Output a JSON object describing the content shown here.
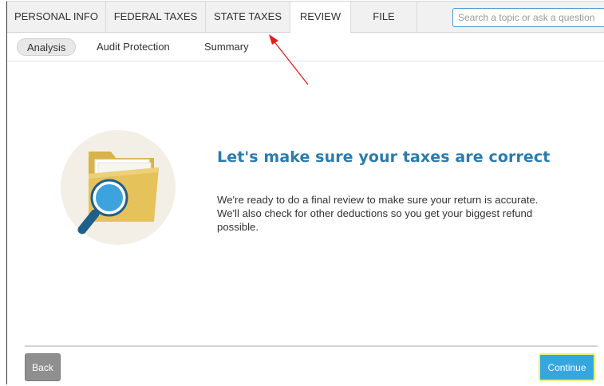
{
  "nav": {
    "tabs": [
      {
        "label": "PERSONAL INFO",
        "active": false
      },
      {
        "label": "FEDERAL TAXES",
        "active": false
      },
      {
        "label": "STATE TAXES",
        "active": false
      },
      {
        "label": "REVIEW",
        "active": true
      },
      {
        "label": "FILE",
        "active": false
      }
    ],
    "search_placeholder": "Search a topic or ask a question"
  },
  "subnav": {
    "tabs": [
      {
        "label": "Analysis",
        "active": true
      },
      {
        "label": "Audit Protection",
        "active": false
      },
      {
        "label": "Summary",
        "active": false
      }
    ]
  },
  "main": {
    "illustration_icon": "folder-magnifier-icon",
    "headline": "Let's make sure your taxes are correct",
    "description": "We're ready to do a final review to make sure your return is accurate. We'll also check for other deductions so you get your biggest refund possible."
  },
  "footer": {
    "back_label": "Back",
    "continue_label": "Continue"
  },
  "annotation": {
    "icon": "red-arrow-icon",
    "color": "#e02020"
  },
  "colors": {
    "headline": "#2a7bb0",
    "continue_button": "#35a7e0",
    "continue_outline": "#ecf36a",
    "back_button": "#8f8f8f"
  }
}
